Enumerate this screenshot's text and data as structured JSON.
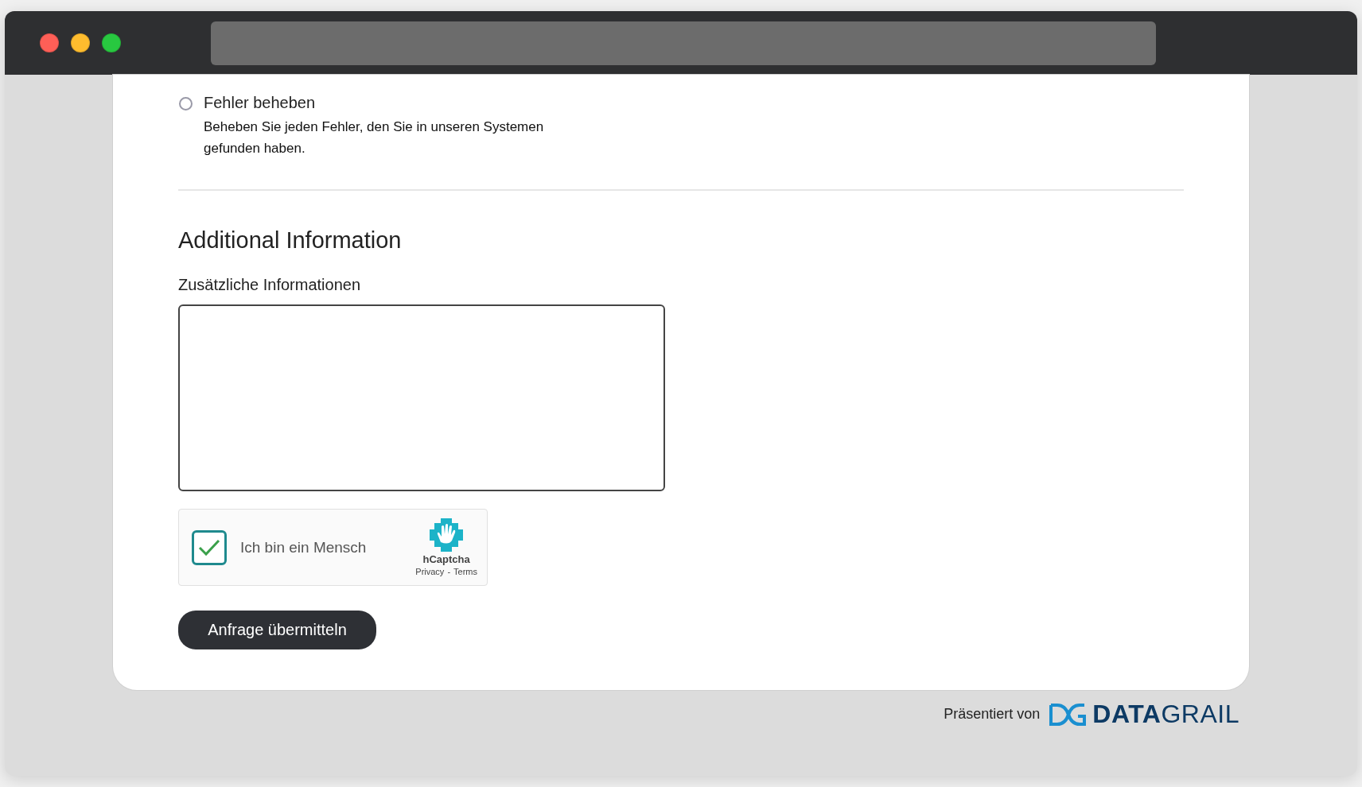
{
  "radio_options": [
    {
      "label": "Fehler beheben",
      "description": "Beheben Sie jeden Fehler, den Sie in unseren Systemen gefunden haben.",
      "selected": false
    }
  ],
  "section": {
    "heading": "Additional Information",
    "field_label": "Zusätzliche Informationen"
  },
  "captcha": {
    "label": "Ich bin ein Mensch",
    "checked": true,
    "brand": "hCaptcha",
    "links": [
      "Privacy",
      "Terms"
    ],
    "separator": "-"
  },
  "submit_button": "Anfrage übermitteln",
  "footer": {
    "text": "Präsentiert von",
    "logo": "**DATA**GRAIL"
  }
}
